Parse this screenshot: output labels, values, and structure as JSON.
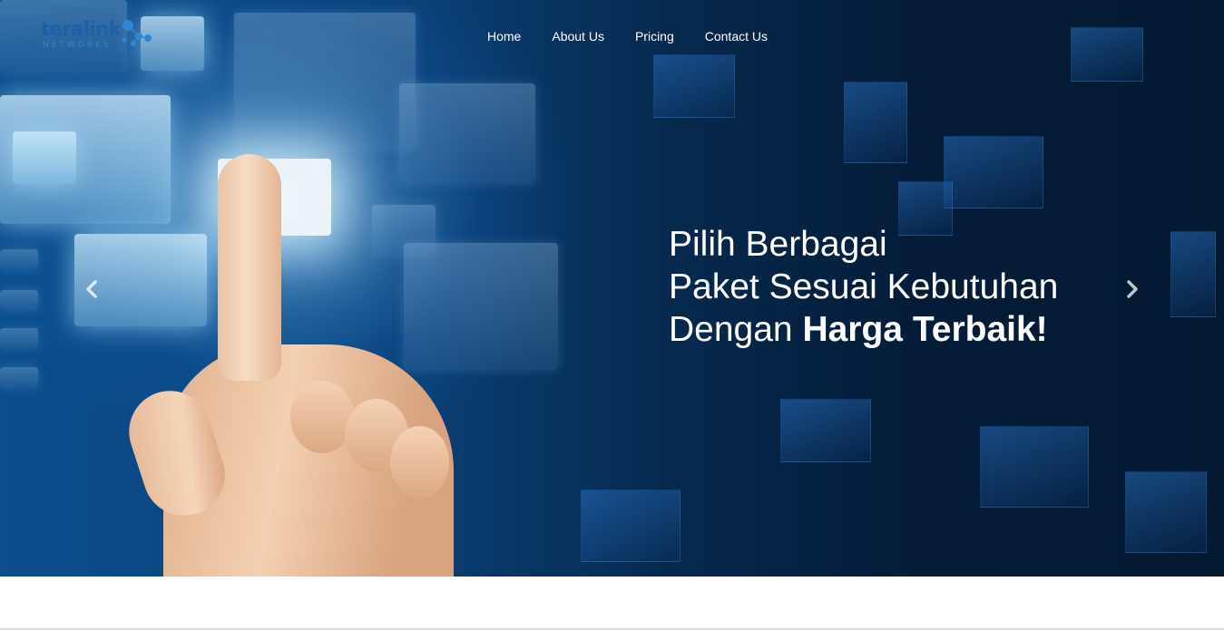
{
  "brand": {
    "name": "teralink",
    "sub": "NETWORKS"
  },
  "nav": {
    "items": [
      {
        "label": "Home"
      },
      {
        "label": "About Us"
      },
      {
        "label": "Pricing"
      },
      {
        "label": "Contact Us"
      }
    ]
  },
  "hero": {
    "line1": "Pilih Berbagai",
    "line2": "Paket Sesuai Kebutuhan",
    "line3_prefix": "Dengan ",
    "line3_bold": "Harga Terbaik",
    "line3_suffix": "!",
    "prev_icon": "chevron-left-icon",
    "next_icon": "chevron-right-icon"
  },
  "colors": {
    "brand_blue": "#1d5fa8",
    "brand_dot": "#2e86d6",
    "hero_dark": "#041c38",
    "nav_text": "#ffffff"
  }
}
